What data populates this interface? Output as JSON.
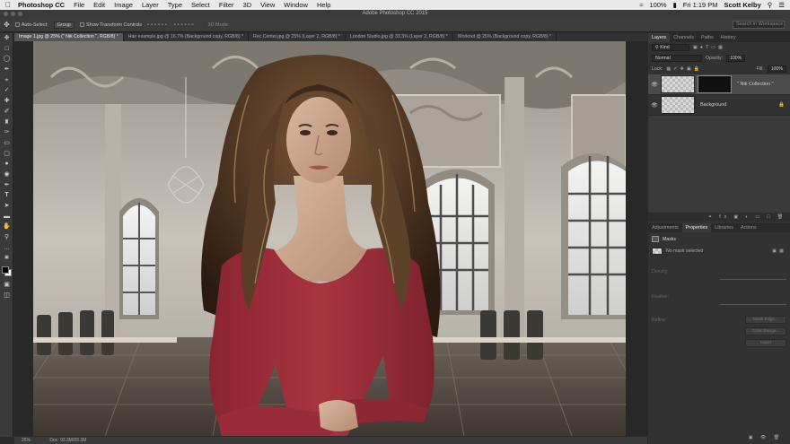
{
  "menubar": {
    "app": "Photoshop CC",
    "items": [
      "File",
      "Edit",
      "Image",
      "Layer",
      "Type",
      "Select",
      "Filter",
      "3D",
      "View",
      "Window",
      "Help"
    ],
    "battery": "100%",
    "time": "Fri 1:19 PM",
    "user": "Scott Kelby"
  },
  "window": {
    "title": "Adobe Photoshop CC 2015"
  },
  "options": {
    "auto_select": "Auto-Select:",
    "auto_select_value": "Group",
    "transform": "Show Transform Controls",
    "mode_3d": "3D Mode:",
    "search_placeholder": "Search in Workspace"
  },
  "tabs": [
    "Image 1.jpg @ 25% (\" Nik Collection \", RGB/8) *",
    "Hair example.jpg @ 16.7% (Background copy, RGB/8) *",
    "Rec Center.jpg @ 25% (Layer 2, RGB/8) *",
    "London Studio.jpg @ 33.3% (Layer 2, RGB/8) *",
    "Workout @ 25% (Background copy, RGB/8) *"
  ],
  "status": {
    "zoom": "25%",
    "doc": "Doc: 93.3M/93.3M"
  },
  "layers_panel": {
    "tabs": [
      "Layers",
      "Channels",
      "Paths",
      "History"
    ],
    "kind": "Kind",
    "blend": "Normal",
    "opacity_label": "Opacity:",
    "opacity": "100%",
    "lock_label": "Lock:",
    "fill_label": "Fill:",
    "fill": "100%",
    "layers": [
      {
        "name": "\" Nik Collection \"",
        "has_mask": true
      },
      {
        "name": "Background",
        "has_mask": false
      }
    ]
  },
  "props_panel": {
    "tabs": [
      "Adjustments",
      "Properties",
      "Libraries",
      "Actions"
    ],
    "section": "Masks",
    "status": "No mask selected",
    "density": "Density:",
    "feather": "Feather:",
    "refine": "Refine:",
    "buttons": [
      "Mask Edge...",
      "Color Range...",
      "Invert"
    ]
  },
  "colors": {
    "accent": "#4a90d9",
    "shirt": "#a3303f"
  }
}
